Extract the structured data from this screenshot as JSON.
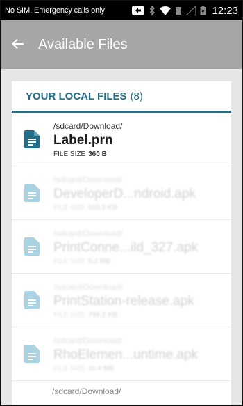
{
  "status_bar": {
    "carrier": "No SIM, Emergency calls only",
    "time": "12:23"
  },
  "app_bar": {
    "title": "Available Files"
  },
  "section": {
    "header": "YOUR LOCAL FILES",
    "count": "(8)"
  },
  "files": [
    {
      "path": "/sdcard/Download/",
      "name": "Label.prn",
      "size_label": "FILE SIZE",
      "size": "360 B"
    },
    {
      "path": "/sdcard/Download/",
      "name": "DeveloperD...ndroid.apk",
      "size_label": "FILE SIZE",
      "size": "515.5 KB"
    },
    {
      "path": "/sdcard/Download/",
      "name": "PrintConne...ild_327.apk",
      "size_label": "FILE SIZE",
      "size": "5.2 MB"
    },
    {
      "path": "/sdcard/Download/",
      "name": "PrintStation-release.apk",
      "size_label": "FILE SIZE",
      "size": "796.2 KB"
    },
    {
      "path": "/sdcard/Download/",
      "name": "RhoElemen...untime.apk",
      "size_label": "FILE SIZE",
      "size": "11.4 MB"
    }
  ],
  "partial_row": {
    "path": "/sdcard/Download/"
  },
  "colors": {
    "accent": "#1f6f8b",
    "appbar": "#a6a6a6",
    "icon_active": "#1f6f8b",
    "icon_faded": "#a9d3e3"
  },
  "icons": {
    "back": "arrow-back-icon",
    "file": "document-icon",
    "notification": "notification-icon",
    "bluetooth": "bluetooth-icon",
    "wifi": "wifi-icon",
    "signal": "signal-icon",
    "battery": "battery-icon"
  }
}
